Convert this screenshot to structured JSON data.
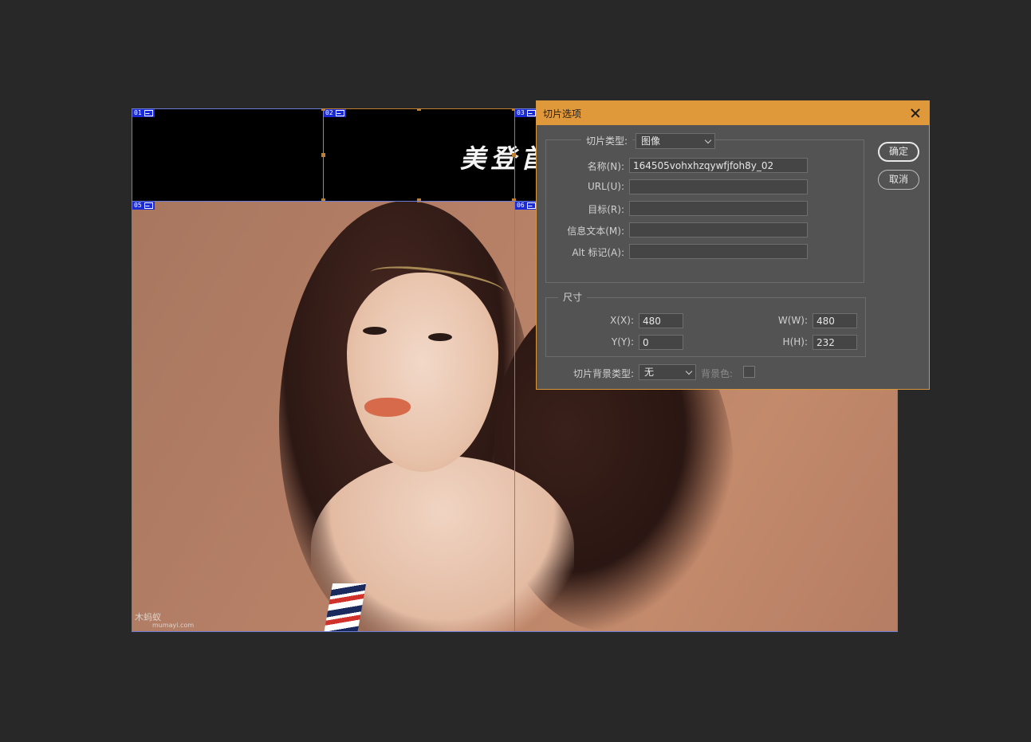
{
  "canvas": {
    "banner_text": "美登首",
    "watermark": "木蚂蚁",
    "watermark_sub": "mumayi.com",
    "slices": [
      {
        "id": "01"
      },
      {
        "id": "02"
      },
      {
        "id": "03"
      },
      {
        "id": "05"
      },
      {
        "id": "06"
      }
    ]
  },
  "dialog": {
    "title": "切片选项",
    "slice_type_label": "切片类型:",
    "slice_type_value": "图像",
    "name_label": "名称(N):",
    "name_value": "164505vohxhzqywfjfoh8y_02",
    "url_label": "URL(U):",
    "url_value": "",
    "target_label": "目标(R):",
    "target_value": "",
    "message_label": "信息文本(M):",
    "message_value": "",
    "alt_label": "Alt 标记(A):",
    "alt_value": "",
    "dimensions_legend": "尺寸",
    "x_label": "X(X):",
    "x_value": "480",
    "y_label": "Y(Y):",
    "y_value": "0",
    "w_label": "W(W):",
    "w_value": "480",
    "h_label": "H(H):",
    "h_value": "232",
    "bg_type_label": "切片背景类型:",
    "bg_type_value": "无",
    "bg_color_label": "背景色:",
    "ok_label": "确定",
    "cancel_label": "取消"
  },
  "colors": {
    "accent": "#e0993a",
    "slice_tag": "#1a2bd6",
    "slice_border": "#6a7dd6",
    "active_slice": "#c08030"
  }
}
